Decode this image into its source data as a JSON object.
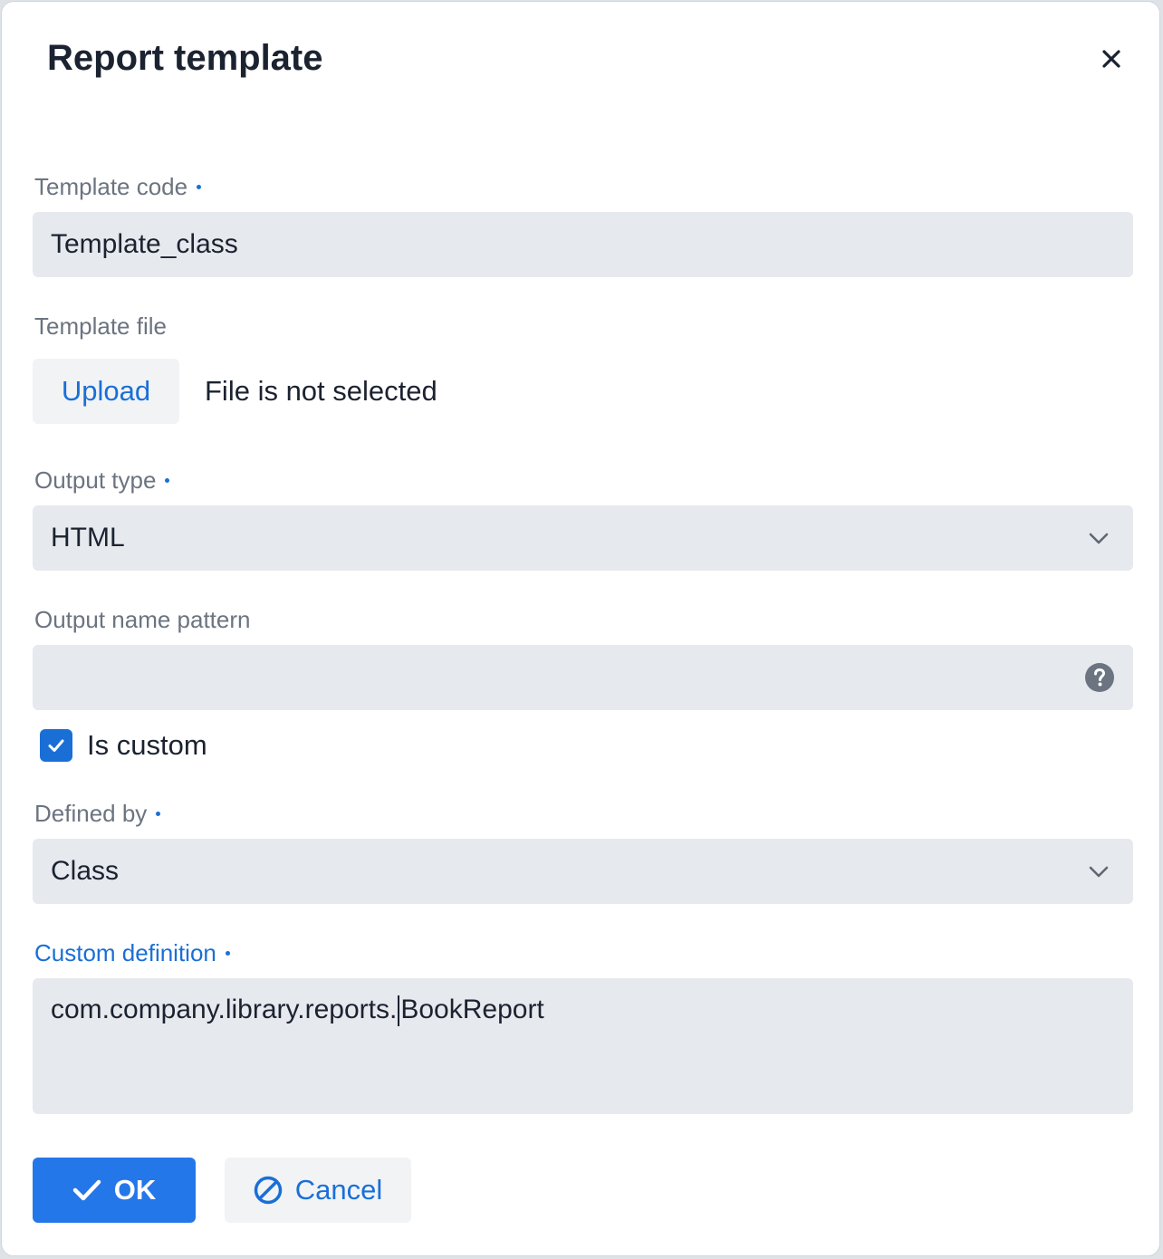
{
  "dialog": {
    "title": "Report template",
    "close_icon": "close-icon"
  },
  "fields": {
    "template_code": {
      "label": "Template code",
      "required": true,
      "value": "Template_class"
    },
    "template_file": {
      "label": "Template file",
      "upload_label": "Upload",
      "status": "File is not selected"
    },
    "output_type": {
      "label": "Output type",
      "required": true,
      "value": "HTML",
      "icon": "chevron-down-icon"
    },
    "output_name_pattern": {
      "label": "Output name pattern",
      "value": "",
      "icon": "help-icon"
    },
    "is_custom": {
      "label": "Is custom",
      "checked": true
    },
    "defined_by": {
      "label": "Defined by",
      "required": true,
      "value": "Class",
      "icon": "chevron-down-icon"
    },
    "custom_definition": {
      "label": "Custom definition",
      "required": true,
      "value_before_caret": "com.company.library.reports.",
      "value_after_caret": "BookReport"
    }
  },
  "actions": {
    "ok_label": "OK",
    "ok_icon": "checkmark-icon",
    "cancel_label": "Cancel",
    "cancel_icon": "cancel-icon"
  },
  "colors": {
    "accent": "#2477e8",
    "link": "#1a6fd6",
    "field_bg": "#e6e9ed",
    "label": "#6b7480",
    "text": "#1b2230"
  }
}
